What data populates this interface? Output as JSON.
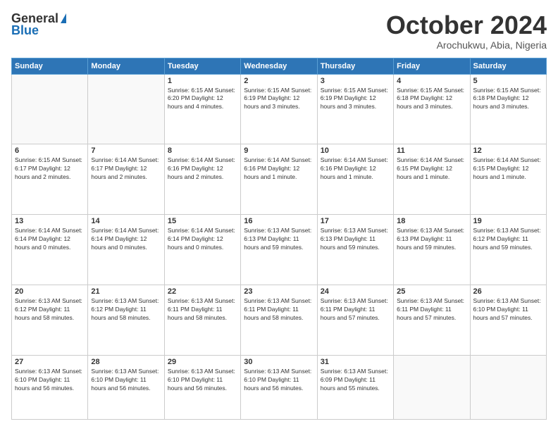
{
  "logo": {
    "general": "General",
    "blue": "Blue"
  },
  "title": {
    "month_year": "October 2024",
    "location": "Arochukwu, Abia, Nigeria"
  },
  "days_of_week": [
    "Sunday",
    "Monday",
    "Tuesday",
    "Wednesday",
    "Thursday",
    "Friday",
    "Saturday"
  ],
  "weeks": [
    [
      {
        "day": "",
        "info": ""
      },
      {
        "day": "",
        "info": ""
      },
      {
        "day": "1",
        "info": "Sunrise: 6:15 AM\nSunset: 6:20 PM\nDaylight: 12 hours\nand 4 minutes."
      },
      {
        "day": "2",
        "info": "Sunrise: 6:15 AM\nSunset: 6:19 PM\nDaylight: 12 hours\nand 3 minutes."
      },
      {
        "day": "3",
        "info": "Sunrise: 6:15 AM\nSunset: 6:19 PM\nDaylight: 12 hours\nand 3 minutes."
      },
      {
        "day": "4",
        "info": "Sunrise: 6:15 AM\nSunset: 6:18 PM\nDaylight: 12 hours\nand 3 minutes."
      },
      {
        "day": "5",
        "info": "Sunrise: 6:15 AM\nSunset: 6:18 PM\nDaylight: 12 hours\nand 3 minutes."
      }
    ],
    [
      {
        "day": "6",
        "info": "Sunrise: 6:15 AM\nSunset: 6:17 PM\nDaylight: 12 hours\nand 2 minutes."
      },
      {
        "day": "7",
        "info": "Sunrise: 6:14 AM\nSunset: 6:17 PM\nDaylight: 12 hours\nand 2 minutes."
      },
      {
        "day": "8",
        "info": "Sunrise: 6:14 AM\nSunset: 6:16 PM\nDaylight: 12 hours\nand 2 minutes."
      },
      {
        "day": "9",
        "info": "Sunrise: 6:14 AM\nSunset: 6:16 PM\nDaylight: 12 hours\nand 1 minute."
      },
      {
        "day": "10",
        "info": "Sunrise: 6:14 AM\nSunset: 6:16 PM\nDaylight: 12 hours\nand 1 minute."
      },
      {
        "day": "11",
        "info": "Sunrise: 6:14 AM\nSunset: 6:15 PM\nDaylight: 12 hours\nand 1 minute."
      },
      {
        "day": "12",
        "info": "Sunrise: 6:14 AM\nSunset: 6:15 PM\nDaylight: 12 hours\nand 1 minute."
      }
    ],
    [
      {
        "day": "13",
        "info": "Sunrise: 6:14 AM\nSunset: 6:14 PM\nDaylight: 12 hours\nand 0 minutes."
      },
      {
        "day": "14",
        "info": "Sunrise: 6:14 AM\nSunset: 6:14 PM\nDaylight: 12 hours\nand 0 minutes."
      },
      {
        "day": "15",
        "info": "Sunrise: 6:14 AM\nSunset: 6:14 PM\nDaylight: 12 hours\nand 0 minutes."
      },
      {
        "day": "16",
        "info": "Sunrise: 6:13 AM\nSunset: 6:13 PM\nDaylight: 11 hours\nand 59 minutes."
      },
      {
        "day": "17",
        "info": "Sunrise: 6:13 AM\nSunset: 6:13 PM\nDaylight: 11 hours\nand 59 minutes."
      },
      {
        "day": "18",
        "info": "Sunrise: 6:13 AM\nSunset: 6:13 PM\nDaylight: 11 hours\nand 59 minutes."
      },
      {
        "day": "19",
        "info": "Sunrise: 6:13 AM\nSunset: 6:12 PM\nDaylight: 11 hours\nand 59 minutes."
      }
    ],
    [
      {
        "day": "20",
        "info": "Sunrise: 6:13 AM\nSunset: 6:12 PM\nDaylight: 11 hours\nand 58 minutes."
      },
      {
        "day": "21",
        "info": "Sunrise: 6:13 AM\nSunset: 6:12 PM\nDaylight: 11 hours\nand 58 minutes."
      },
      {
        "day": "22",
        "info": "Sunrise: 6:13 AM\nSunset: 6:11 PM\nDaylight: 11 hours\nand 58 minutes."
      },
      {
        "day": "23",
        "info": "Sunrise: 6:13 AM\nSunset: 6:11 PM\nDaylight: 11 hours\nand 58 minutes."
      },
      {
        "day": "24",
        "info": "Sunrise: 6:13 AM\nSunset: 6:11 PM\nDaylight: 11 hours\nand 57 minutes."
      },
      {
        "day": "25",
        "info": "Sunrise: 6:13 AM\nSunset: 6:11 PM\nDaylight: 11 hours\nand 57 minutes."
      },
      {
        "day": "26",
        "info": "Sunrise: 6:13 AM\nSunset: 6:10 PM\nDaylight: 11 hours\nand 57 minutes."
      }
    ],
    [
      {
        "day": "27",
        "info": "Sunrise: 6:13 AM\nSunset: 6:10 PM\nDaylight: 11 hours\nand 56 minutes."
      },
      {
        "day": "28",
        "info": "Sunrise: 6:13 AM\nSunset: 6:10 PM\nDaylight: 11 hours\nand 56 minutes."
      },
      {
        "day": "29",
        "info": "Sunrise: 6:13 AM\nSunset: 6:10 PM\nDaylight: 11 hours\nand 56 minutes."
      },
      {
        "day": "30",
        "info": "Sunrise: 6:13 AM\nSunset: 6:10 PM\nDaylight: 11 hours\nand 56 minutes."
      },
      {
        "day": "31",
        "info": "Sunrise: 6:13 AM\nSunset: 6:09 PM\nDaylight: 11 hours\nand 55 minutes."
      },
      {
        "day": "",
        "info": ""
      },
      {
        "day": "",
        "info": ""
      }
    ]
  ]
}
